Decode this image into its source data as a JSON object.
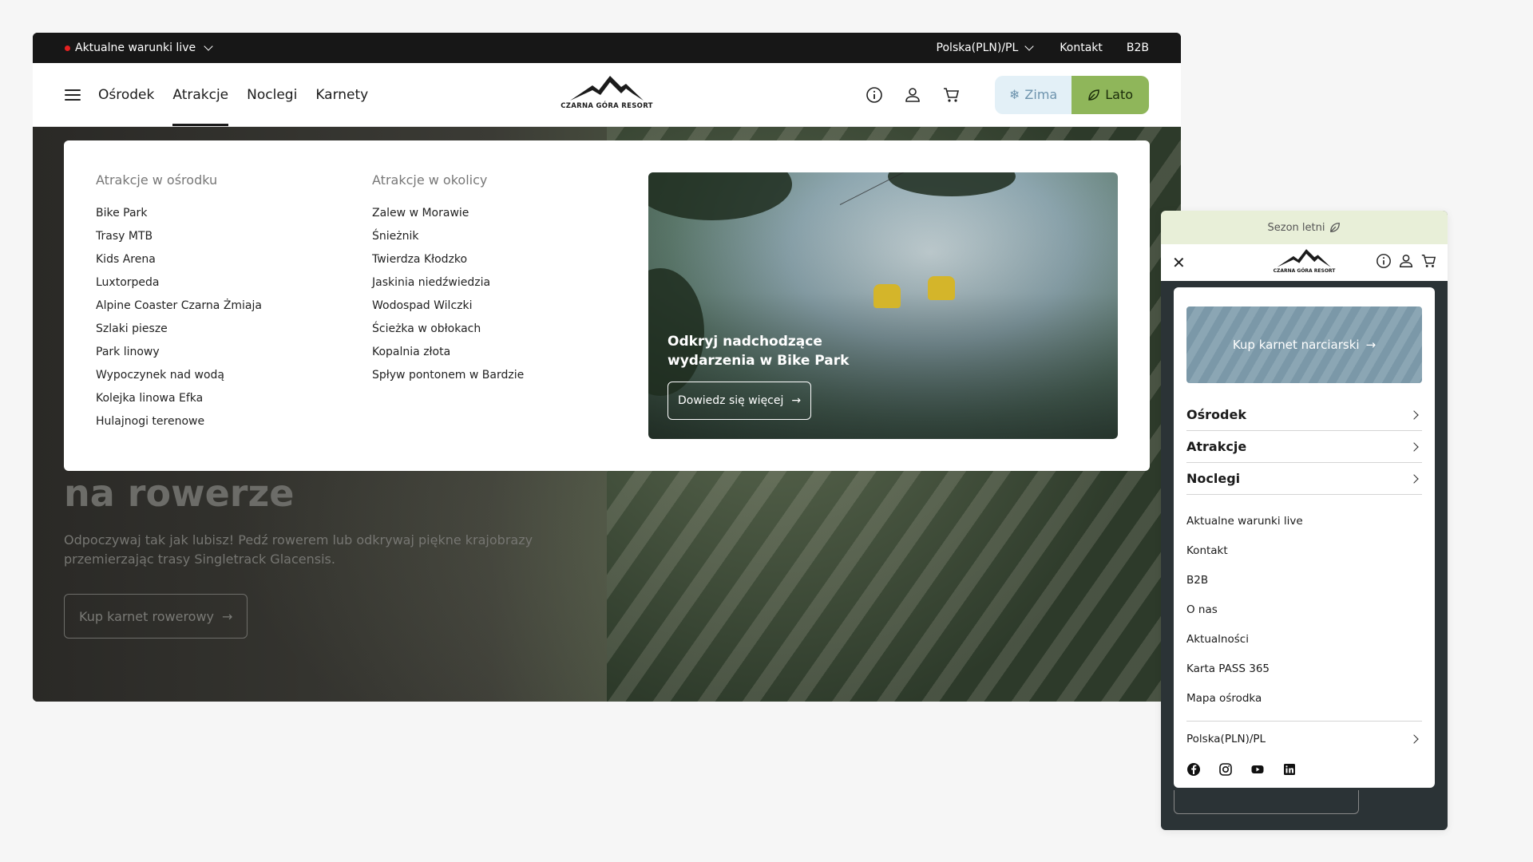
{
  "desktop": {
    "topbar": {
      "live_label": "Aktualne warunki live",
      "region_label": "Polska(PLN)/PL",
      "contact_label": "Kontakt",
      "b2b_label": "B2B"
    },
    "nav": {
      "items": [
        "Ośrodek",
        "Atrakcje",
        "Noclegi",
        "Karnety"
      ],
      "active": "Atrakcje",
      "logo_text": "CZARNA GÓRA RESORT",
      "season_winter": "Zima",
      "season_summer": "Lato"
    },
    "mega_menu": {
      "col1_title": "Atrakcje w ośrodku",
      "col1_items": [
        "Bike Park",
        "Trasy MTB",
        "Kids Arena",
        "Luxtorpeda",
        "Alpine Coaster Czarna Żmiaja",
        "Szlaki piesze",
        "Park linowy",
        "Wypoczynek nad wodą",
        "Kolejka linowa Efka",
        "Hulajnogi terenowe"
      ],
      "col2_title": "Atrakcje w okolicy",
      "col2_items": [
        "Zalew w Morawie",
        "Śnieżnik",
        "Twierdza Kłodzko",
        "Jaskinia niedźwiedzia",
        "Wodospad Wilczki",
        "Ścieżka w obłokach",
        "Kopalnia złota",
        "Spływ pontonem w Bardzie"
      ],
      "promo_title": "Odkryj nadchodzące wydarzenia w Bike Park",
      "promo_button": "Dowiedz się więcej"
    },
    "hero": {
      "title": "na rowerze",
      "subtitle": "Odpoczywaj tak jak lubisz! Pedź rowerem lub odkrywaj piękne krajobrazy przemierzając trasy Singletrack Glacensis.",
      "button": "Kup karnet rowerowy"
    }
  },
  "mobile": {
    "season_label": "Sezon letni",
    "logo_text": "CZARNA GÓRA RESORT",
    "promo_button": "Kup karnet narciarski",
    "sections": [
      "Ośrodek",
      "Atrakcje",
      "Noclegi"
    ],
    "links": [
      "Aktualne warunki live",
      "Kontakt",
      "B2B",
      "O nas",
      "Aktualności",
      "Karta PASS 365",
      "Mapa ośrodka"
    ],
    "region_label": "Polska(PLN)/PL",
    "social": [
      "facebook-icon",
      "instagram-icon",
      "youtube-icon",
      "linkedin-icon"
    ]
  },
  "colors": {
    "live_dot": "#e52121",
    "summer_accent": "#8fb65a",
    "winter_accent": "#e3f0f7",
    "topbar_bg": "#171717"
  }
}
